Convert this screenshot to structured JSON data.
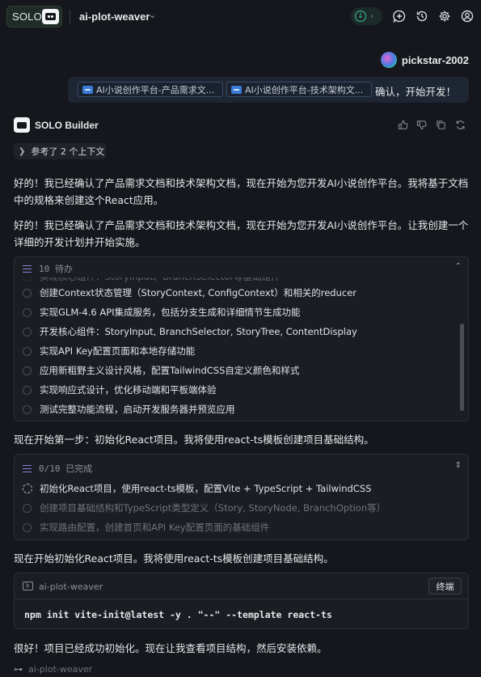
{
  "header": {
    "logo_text": "SOLO",
    "project_name": "ai-plot-weaver",
    "icons": [
      "chevron-down-icon",
      "status-check-icon",
      "new-chat-icon",
      "history-icon",
      "settings-icon",
      "account-icon"
    ]
  },
  "user_message": {
    "username": "pickstar-2002",
    "refs": [
      "AI小说创作平台-产品需求文...",
      "AI小说创作平台-技术架构文..."
    ],
    "text": "确认，开始开发！"
  },
  "builder": {
    "name": "SOLO Builder",
    "context_label": "参考了 2 个上下文"
  },
  "messages": {
    "p1": "好的！我已经确认了产品需求文档和技术架构文档，现在开始为您开发AI小说创作平台。我将基于文档中的规格来创建这个React应用。",
    "p2": "好的！我已经确认了产品需求文档和技术架构文档，现在开始为您开发AI小说创作平台。让我创建一个详细的开发计划并开始实施。",
    "p3": "现在开始第一步：初始化React项目。我将使用react-ts模板创建项目基础结构。",
    "p4": "现在开始初始化React项目。我将使用react-ts模板创建项目基础结构。",
    "p5": "很好！项目已经成功初始化。现在让我查看项目结构，然后安装依赖。"
  },
  "todo_panel_1": {
    "header": "10 待办",
    "partial_task": "实现核心组件：StoryInput、BranchSelector等基础组件",
    "tasks": [
      "创建Context状态管理（StoryContext, ConfigContext）和相关的reducer",
      "实现GLM-4.6 API集成服务，包括分支生成和详细情节生成功能",
      "开发核心组件：StoryInput, BranchSelector, StoryTree, ContentDisplay",
      "实现API Key配置页面和本地存储功能",
      "应用新粗野主义设计风格，配置TailwindCSS自定义颜色和样式",
      "实现响应式设计，优化移动端和平板端体验",
      "测试完整功能流程，启动开发服务器并预览应用"
    ]
  },
  "todo_panel_2": {
    "header": "0/10 已完成",
    "tasks": [
      {
        "text": "初始化React项目，使用react-ts模板，配置Vite + TypeScript + TailwindCSS",
        "state": "in-progress"
      },
      {
        "text": "创建项目基础结构和TypeScript类型定义（Story, StoryNode, BranchOption等）",
        "state": "pending"
      },
      {
        "text": "实现路由配置，创建首页和API Key配置页面的基础组件",
        "state": "pending"
      }
    ]
  },
  "terminal": {
    "title": "ai-plot-weaver",
    "button": "终端",
    "command": "npm init vite-init@latest -y . \"--\" --template react-ts"
  },
  "footer": {
    "label": "ai-plot-weaver"
  },
  "colors": {
    "background": "#15171c",
    "panel": "#1b1d22",
    "accent_green": "#3fbf8a",
    "accent_blue": "#3a7bd5",
    "accent_purple": "#8b7fd9"
  }
}
